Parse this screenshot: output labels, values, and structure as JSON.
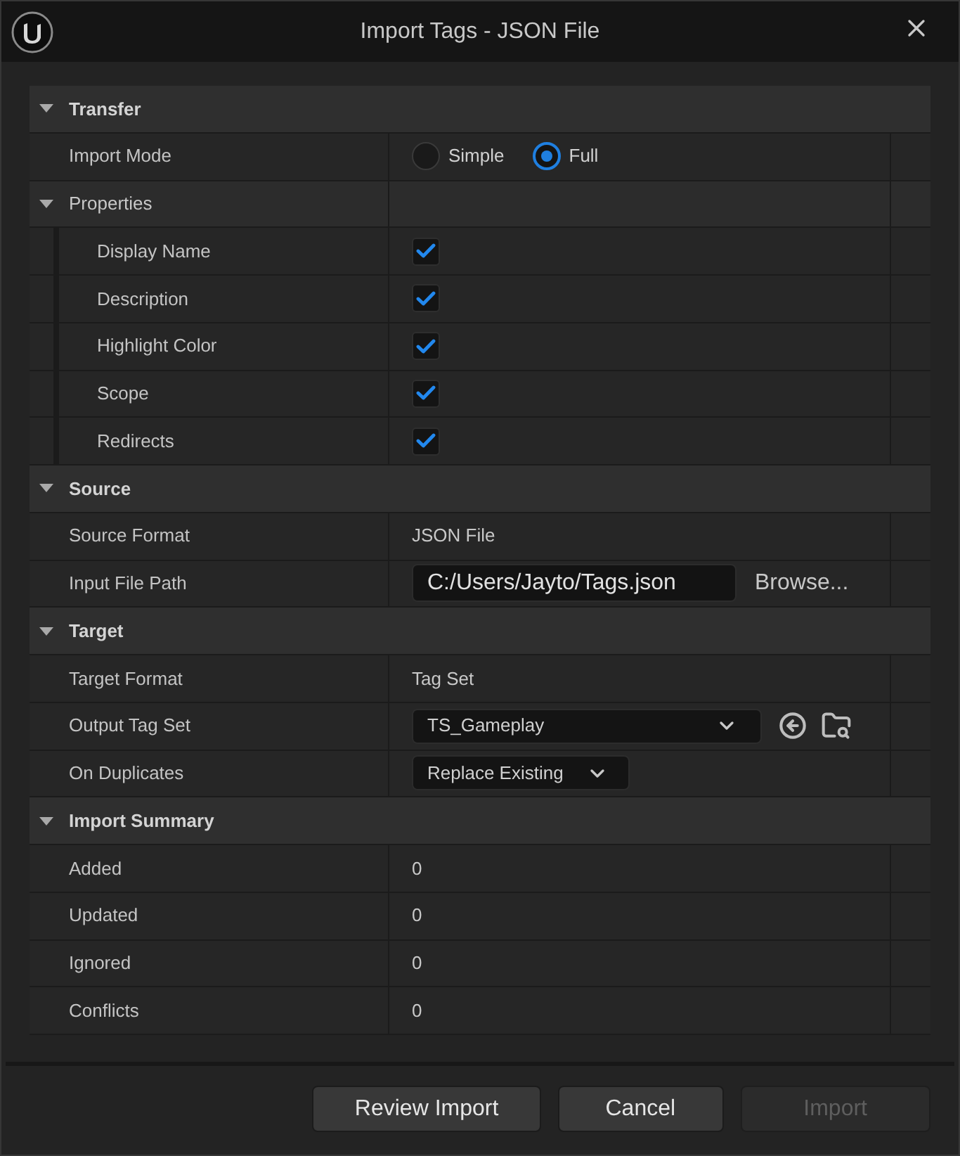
{
  "window": {
    "title": "Import Tags - JSON File"
  },
  "sections": [
    {
      "title": "Transfer",
      "expanded": true,
      "rows": [
        {
          "kind": "radio",
          "label": "Import Mode",
          "options": [
            {
              "label": "Simple",
              "selected": false
            },
            {
              "label": "Full",
              "selected": true
            }
          ]
        },
        {
          "kind": "group",
          "label": "Properties",
          "expanded": true,
          "children": [
            {
              "kind": "checkbox",
              "label": "Display Name",
              "checked": true
            },
            {
              "kind": "checkbox",
              "label": "Description",
              "checked": true
            },
            {
              "kind": "checkbox",
              "label": "Highlight Color",
              "checked": true
            },
            {
              "kind": "checkbox",
              "label": "Scope",
              "checked": true
            },
            {
              "kind": "checkbox",
              "label": "Redirects",
              "checked": true
            }
          ]
        }
      ]
    },
    {
      "title": "Source",
      "expanded": true,
      "rows": [
        {
          "kind": "text",
          "label": "Source Format",
          "value": "JSON File"
        },
        {
          "kind": "file",
          "label": "Input File Path",
          "value": "C:/Users/Jayto/Tags.json",
          "button": "Browse..."
        }
      ]
    },
    {
      "title": "Target",
      "expanded": true,
      "rows": [
        {
          "kind": "text",
          "label": "Target Format",
          "value": "Tag Set"
        },
        {
          "kind": "asset",
          "label": "Output Tag Set",
          "value": "TS_Gameplay"
        },
        {
          "kind": "combo",
          "label": "On Duplicates",
          "value": "Replace Existing"
        }
      ]
    },
    {
      "title": "Import Summary",
      "expanded": true,
      "rows": [
        {
          "kind": "text",
          "label": "Added",
          "value": "0"
        },
        {
          "kind": "text",
          "label": "Updated",
          "value": "0"
        },
        {
          "kind": "text",
          "label": "Ignored",
          "value": "0"
        },
        {
          "kind": "text",
          "label": "Conflicts",
          "value": "0"
        }
      ]
    }
  ],
  "buttons": [
    {
      "label": "Review Import",
      "disabled": false
    },
    {
      "label": "Cancel",
      "disabled": false
    },
    {
      "label": "Import",
      "disabled": true
    }
  ]
}
